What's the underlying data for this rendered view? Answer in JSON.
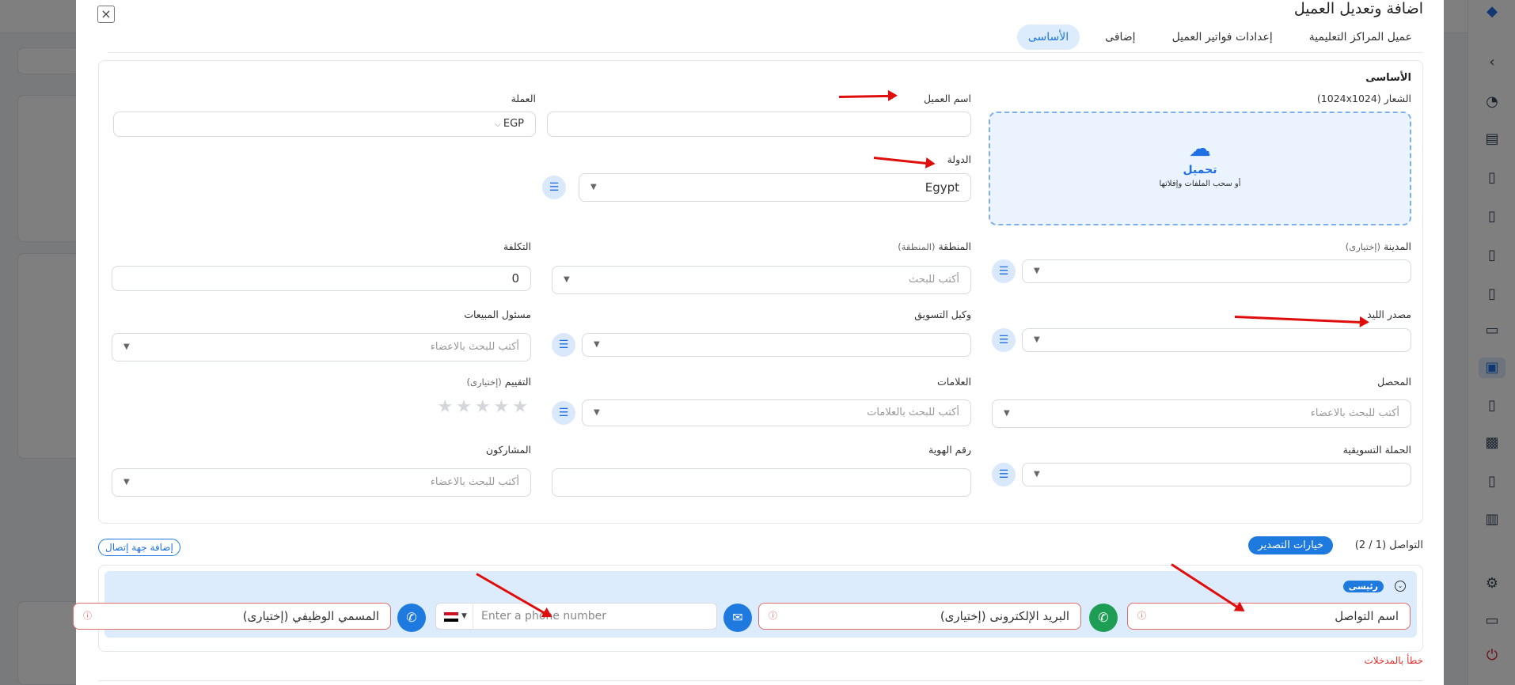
{
  "modal": {
    "title": "اضافة وتعديل العميل",
    "close_icon": "×"
  },
  "tabs": [
    {
      "label": "الأساسى",
      "active": true
    },
    {
      "label": "إضافى"
    },
    {
      "label": "إعدادات فواتير العميل"
    },
    {
      "label": "عميل المراكز التعليمية"
    }
  ],
  "basic": {
    "section_title": "الأساسى",
    "logo_label": "الشعار (1024x1024)",
    "upload_title": "تحميل",
    "upload_hint": "أو سحب الملفات وإفلاتها",
    "client_name_label": "اسم العميل",
    "client_name_value": "",
    "currency_label": "العملة",
    "currency_value": "EGP",
    "country_label": "الدولة",
    "country_value": "Egypt",
    "city_label": "المدينة",
    "city_optional": "(إختيارى)",
    "region_label": "المنطقة",
    "region_optional": "(المنطقة)",
    "region_placeholder": "أكتب للبحث",
    "cost_label": "التكلفة",
    "cost_value": "0",
    "lead_source_label": "مصدر الليد",
    "marketing_agent_label": "وكيل التسويق",
    "sales_rep_label": "مسئول المبيعات",
    "sales_rep_placeholder": "أكتب للبحث بالاعضاء",
    "collector_label": "المحصل",
    "collector_placeholder": "أكتب للبحث بالاعضاء",
    "tags_label": "العلامات",
    "tags_placeholder": "أكتب للبحث بالعلامات",
    "rating_label": "التقييم",
    "rating_optional": "(إختيارى)",
    "rating_stars": "★★★★★",
    "rating_value": 0,
    "campaign_label": "الحملة التسويقية",
    "id_number_label": "رقم الهوية",
    "participants_label": "المشاركون",
    "participants_placeholder": "أكتب للبحث بالاعضاء"
  },
  "contacts": {
    "label": "التواصل (1 / 2)",
    "export_button": "خيارات التصدير",
    "add_contact_button": "إضافة جهة إتصال",
    "primary_badge": "رئيسى",
    "contact_name_placeholder": "اسم التواصل",
    "email_placeholder": "البريد الإلكترونى (إختيارى)",
    "phone_placeholder": "Enter a phone number",
    "job_title_placeholder": "المسمي الوظيفي (إختيارى)",
    "error_text": "خطأ بالمدخلات"
  },
  "icons": {
    "whatsapp_color": "#1e9e54",
    "email_color": "#1f7ae0",
    "phone_color": "#1f7ae0",
    "accent": "#1f7ae0",
    "error": "#e05555",
    "arrow": "#e00d0d"
  }
}
